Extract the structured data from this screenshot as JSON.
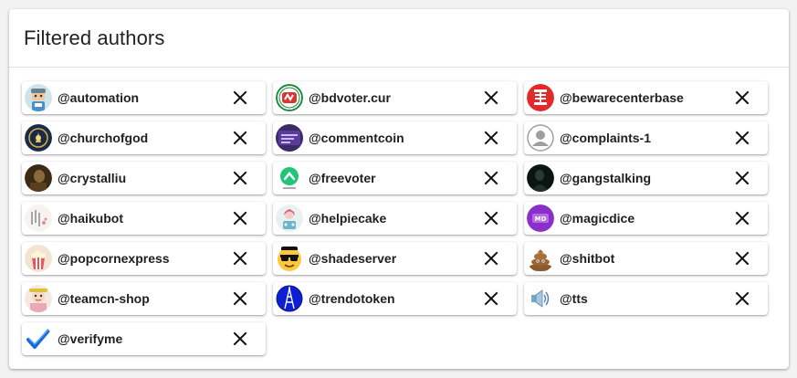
{
  "card": {
    "title": "Filtered authors"
  },
  "authors": [
    {
      "name": "@automation",
      "icon": "robot-avatar-icon"
    },
    {
      "name": "@bdvoter.cur",
      "icon": "bdvoter-logo-icon"
    },
    {
      "name": "@bewarecenterbase",
      "icon": "red-seal-avatar-icon"
    },
    {
      "name": "@churchofgod",
      "icon": "church-avatar-icon"
    },
    {
      "name": "@commentcoin",
      "icon": "comment-avatar-icon"
    },
    {
      "name": "@complaints-1",
      "icon": "default-user-icon"
    },
    {
      "name": "@crystalliu",
      "icon": "photo-avatar-icon"
    },
    {
      "name": "@freevoter",
      "icon": "freevoter-logo-icon"
    },
    {
      "name": "@gangstalking",
      "icon": "dark-figure-avatar-icon"
    },
    {
      "name": "@haikubot",
      "icon": "haiku-avatar-icon"
    },
    {
      "name": "@helpiecake",
      "icon": "helpiecake-avatar-icon"
    },
    {
      "name": "@magicdice",
      "icon": "magicdice-logo-icon"
    },
    {
      "name": "@popcornexpress",
      "icon": "popcorn-avatar-icon"
    },
    {
      "name": "@shadeserver",
      "icon": "sunglasses-emoji-icon"
    },
    {
      "name": "@shitbot",
      "icon": "poop-emoji-icon"
    },
    {
      "name": "@teamcn-shop",
      "icon": "teamcn-avatar-icon"
    },
    {
      "name": "@trendotoken",
      "icon": "tower-logo-icon"
    },
    {
      "name": "@tts",
      "icon": "speaker-icon"
    },
    {
      "name": "@verifyme",
      "icon": "checkmark-icon"
    }
  ],
  "colors": {
    "card_bg": "#ffffff",
    "page_bg": "#f2f2f2",
    "text": "#1f1f1f",
    "close": "#111111"
  }
}
